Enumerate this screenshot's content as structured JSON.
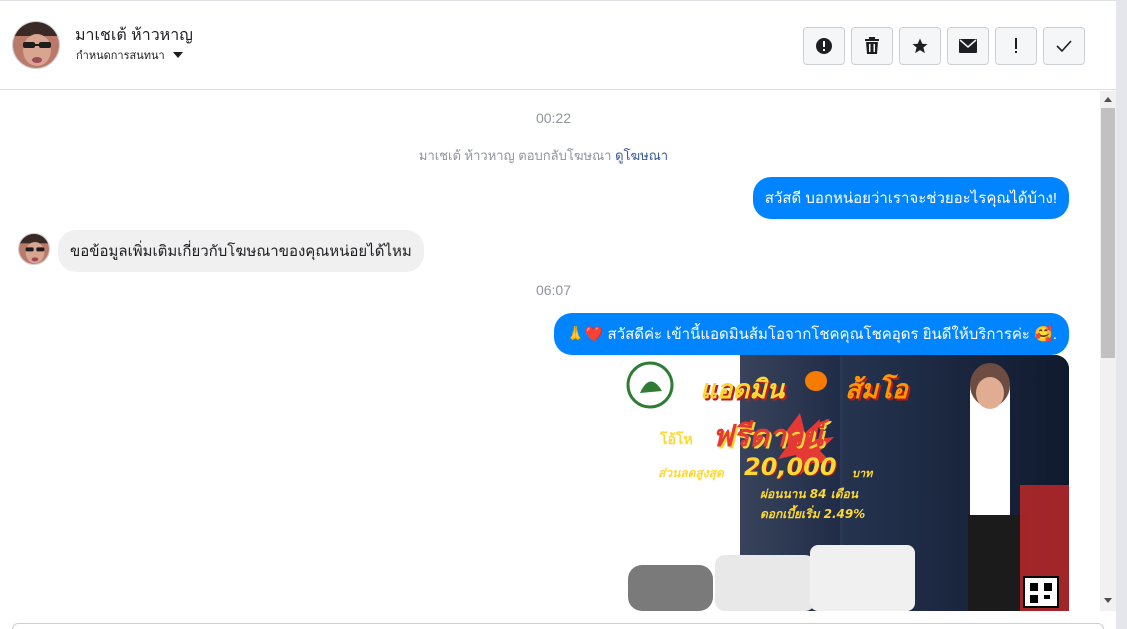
{
  "header": {
    "contact_name": "มาเชเต้ ห้าวหาญ",
    "assign_label": "กำหนดการสนทนา",
    "toolbar": [
      {
        "name": "spam-button",
        "icon": "alert-circle-icon"
      },
      {
        "name": "delete-button",
        "icon": "trash-icon"
      },
      {
        "name": "star-button",
        "icon": "star-icon"
      },
      {
        "name": "mark-unread-button",
        "icon": "envelope-icon"
      },
      {
        "name": "follow-up-button",
        "icon": "exclamation-icon"
      },
      {
        "name": "mark-done-button",
        "icon": "check-icon"
      }
    ]
  },
  "conversation": {
    "timestamp_1": "00:22",
    "ad_reply_text": "มาเชเต้ ห้าวหาญ ตอบกลับโฆษณา",
    "ad_reply_link": "ดูโฆษณา",
    "msg_out_1": "สวัสดี บอกหน่อยว่าเราจะช่วยอะไรคุณได้บ้าง!",
    "msg_in_1": "ขอข้อมูลเพิ่มเติมเกี่ยวกับโฆษณาของคุณหน่อยได้ไหม",
    "timestamp_2": "06:07",
    "msg_out_2": "🙏❤️ สวัสดีค่ะ เข้านี้แอดมินส้มโอจากโชคคุณโชคอุดร ยินดีให้บริการค่ะ 🥰.",
    "ad_image": {
      "headline_1": "แอดมิน",
      "headline_2": "ส้มโอ",
      "badge": "โอ้โห",
      "free_down": "ฟรีดาวน์",
      "discount_label": "ส่วนลดสูงสุด",
      "discount_amount": "20,000",
      "discount_unit": "บาท",
      "installment": "ผ่อนนาน 84 เดือน",
      "interest": "ดอกเบี้ยเริ่ม 2.49%"
    }
  },
  "colors": {
    "accent": "#0084ff",
    "incoming_bubble": "#f1f0f0",
    "link": "#365899"
  }
}
